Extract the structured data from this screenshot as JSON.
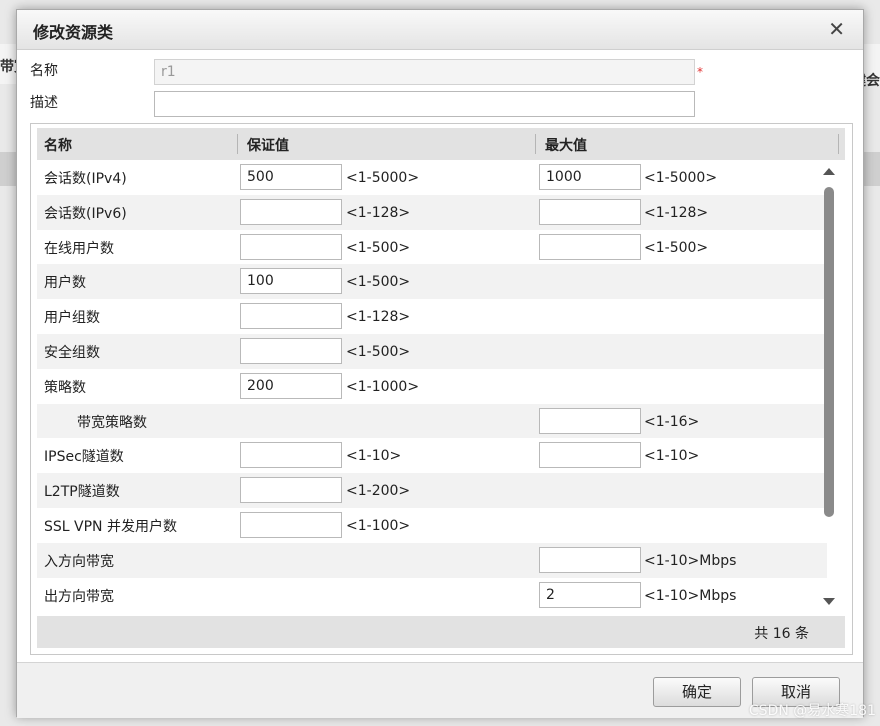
{
  "background": {
    "left_text": "带宽",
    "right_text": "健会"
  },
  "dialog": {
    "title": "修改资源类",
    "close_glyph": "✕",
    "name_label": "名称",
    "name_value": "r1",
    "required_mark": "*",
    "desc_label": "描述",
    "desc_value": ""
  },
  "table": {
    "headers": {
      "name": "名称",
      "guarantee": "保证值",
      "max": "最大值"
    },
    "rows": [
      {
        "name": "会话数(IPv4)",
        "guarantee": "500",
        "guarantee_hint": "<1-5000>",
        "max": "1000",
        "max_hint": "<1-5000>"
      },
      {
        "name": "会话数(IPv6)",
        "guarantee": "",
        "guarantee_hint": "<1-128>",
        "max": "",
        "max_hint": "<1-128>"
      },
      {
        "name": "在线用户数",
        "guarantee": "",
        "guarantee_hint": "<1-500>",
        "max": "",
        "max_hint": "<1-500>"
      },
      {
        "name": "用户数",
        "guarantee": "100",
        "guarantee_hint": "<1-500>"
      },
      {
        "name": "用户组数",
        "guarantee": "",
        "guarantee_hint": "<1-128>"
      },
      {
        "name": "安全组数",
        "guarantee": "",
        "guarantee_hint": "<1-500>"
      },
      {
        "name": "策略数",
        "guarantee": "200",
        "guarantee_hint": "<1-1000>"
      },
      {
        "name": "带宽策略数",
        "max": "",
        "max_hint": "<1-16>"
      },
      {
        "name": "IPSec隧道数",
        "guarantee": "",
        "guarantee_hint": "<1-10>",
        "max": "",
        "max_hint": "<1-10>"
      },
      {
        "name": "L2TP隧道数",
        "guarantee": "",
        "guarantee_hint": "<1-200>"
      },
      {
        "name": "SSL VPN 并发用户数",
        "guarantee": "",
        "guarantee_hint": "<1-100>"
      },
      {
        "name": "入方向带宽",
        "max": "",
        "max_hint": "<1-10>Mbps"
      },
      {
        "name": "出方向带宽",
        "max": "2",
        "max_hint": "<1-10>Mbps"
      }
    ],
    "total_text": "共 16 条"
  },
  "footer": {
    "ok_label": "确定",
    "cancel_label": "取消"
  },
  "watermark": "CSDN @易水寒181"
}
